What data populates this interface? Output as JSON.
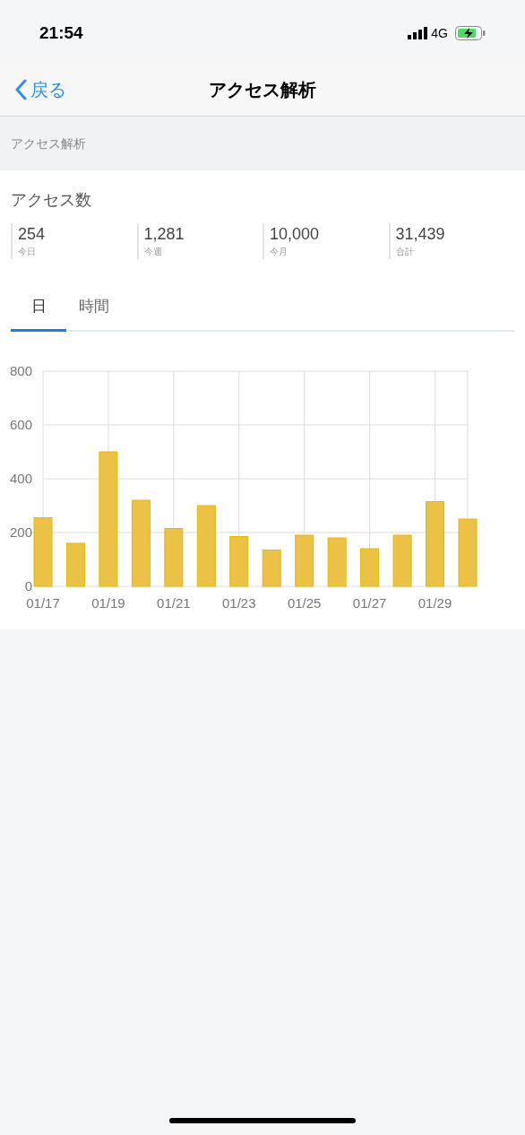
{
  "status_bar": {
    "time": "21:54",
    "network": "4G"
  },
  "nav": {
    "back": "戻る",
    "title": "アクセス解析"
  },
  "section_header": "アクセス解析",
  "card": {
    "title": "アクセス数",
    "stats": [
      {
        "value": "254",
        "label": "今日"
      },
      {
        "value": "1,281",
        "label": "今週"
      },
      {
        "value": "10,000",
        "label": "今月"
      },
      {
        "value": "31,439",
        "label": "合計"
      }
    ],
    "tabs": [
      {
        "label": "日",
        "selected": true
      },
      {
        "label": "時間",
        "selected": false
      }
    ],
    "chart_data": {
      "type": "bar",
      "categories": [
        "01/17",
        null,
        "01/19",
        null,
        "01/21",
        null,
        "01/23",
        null,
        "01/25",
        null,
        "01/27",
        null,
        "01/29",
        null
      ],
      "series": [
        {
          "color": "#ebc146",
          "values": [
            255,
            160,
            500,
            320,
            215,
            300,
            185,
            135,
            190,
            180,
            140,
            190,
            315,
            250
          ]
        }
      ],
      "ylim": [
        0,
        800
      ],
      "yticks": [
        0,
        200,
        400,
        600,
        800
      ],
      "grid": true
    }
  }
}
